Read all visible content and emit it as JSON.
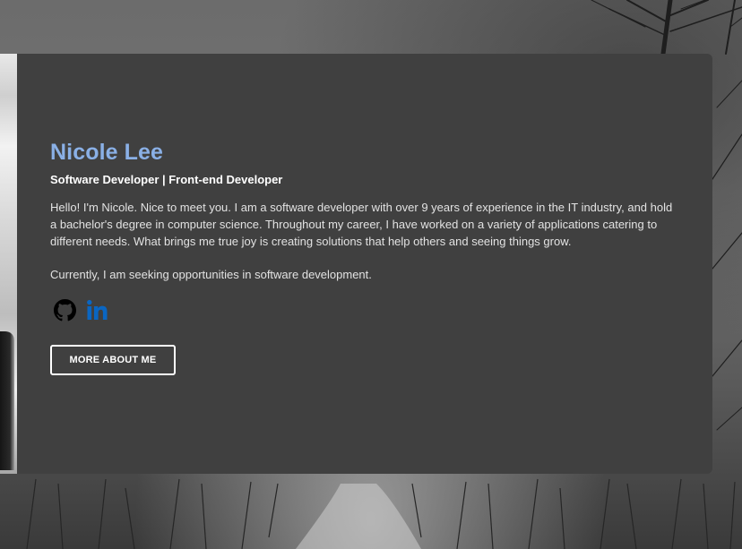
{
  "profile": {
    "name": "Nicole Lee",
    "subtitle": "Software Developer | Front-end Developer",
    "bio": [
      "Hello! I'm Nicole. Nice to meet you. I am a software developer with over 9 years of experience in the IT industry, and hold a bachelor's degree in computer science. Throughout my career, I have worked on a variety of applications catering to different needs. What brings me true joy is creating solutions that help others and seeing things grow.",
      "Currently, I am seeking opportunities in software development."
    ]
  },
  "socials": [
    {
      "icon": "github-icon",
      "color": "#000000"
    },
    {
      "icon": "linkedin-icon",
      "color": "#0a66c2"
    }
  ],
  "cta": {
    "label": "MORE ABOUT ME"
  },
  "colors": {
    "card_bg": "#404040",
    "name": "#8ab0e6",
    "text": "#e2e2e2",
    "button_border": "#ffffff"
  }
}
